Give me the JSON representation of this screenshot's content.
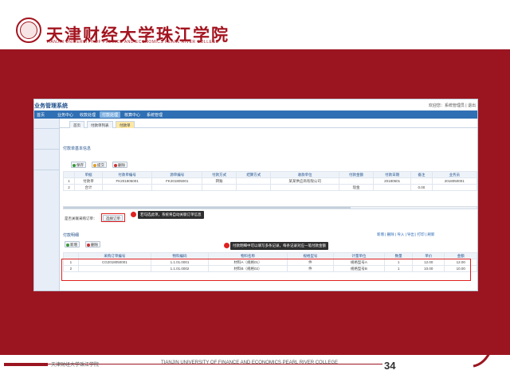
{
  "slide": {
    "logo_text": "天津财经大学珠江学院",
    "logo_en": "TIANJIN UNIVERSITY OF FINANCE AND ECONOMICS PEARL RIVER COLLEGE",
    "footer_cn": "天津财经大学珠江学院",
    "footer_en": "TIANJIN UNIVERSITY OF FINANCE AND ECONOMICS PEARL RIVER COLLEGE",
    "page_number": "34",
    "brand_color": "#9b1520"
  },
  "app": {
    "title": "业务管理系统",
    "user_info": "欢迎您：系统管理员 | 退出",
    "nav": [
      "首页",
      "业务中心",
      "收款处理",
      "付款处理",
      "核算中心",
      "系统管理"
    ],
    "nav_active": 3,
    "tabs": [
      "首页",
      "付款单列表",
      "付款单"
    ],
    "tab_active": 2,
    "section1_title": "付款单基本信息",
    "toolbar1": [
      "保存",
      "提交",
      "删除"
    ],
    "grid1": {
      "headers": [
        "",
        "单据",
        "付款单编号",
        "源单编号",
        "付款方式",
        "结算方式",
        "收款单位",
        "付款金额",
        "付款日期",
        "备注",
        "业务员"
      ],
      "rows": [
        [
          "1",
          "付款单",
          "FK201805001",
          "FK201805001",
          "转账",
          "",
          "某某供应商有限公司",
          "",
          "20180501",
          "",
          "2018050001"
        ],
        [
          "2",
          "合计",
          "",
          "",
          "",
          "",
          "",
          "现金",
          "",
          "0.00",
          ""
        ]
      ]
    },
    "relate_label": "是否关联采购订单：",
    "relate_button": "选择订单",
    "callout1": "若勾选此项，系统将自动关联订单信息",
    "section2_title": "付款明细",
    "section2_links": "新增 | 删除 | 导入 | 导出 | 打印 | 刷新",
    "toolbar2": [
      "新增",
      "删除"
    ],
    "callout2": "付款明细中可以填写多条记录，每条记录对应一笔付款金额",
    "grid2": {
      "headers": [
        "",
        "采购订单编号",
        "物料编码",
        "物料名称",
        "规格型号",
        "计量单位",
        "数量",
        "单价",
        "金额"
      ],
      "rows": [
        [
          "1",
          "CG2018050001",
          "1.1.01.0001",
          "材料A（规格01）",
          "件",
          "规格型号A",
          "1",
          "12.00",
          "12.00"
        ],
        [
          "2",
          "",
          "1.1.01.0002",
          "材料B（规格02）",
          "件",
          "规格型号B",
          "1",
          "10.00",
          "10.00"
        ]
      ]
    }
  }
}
